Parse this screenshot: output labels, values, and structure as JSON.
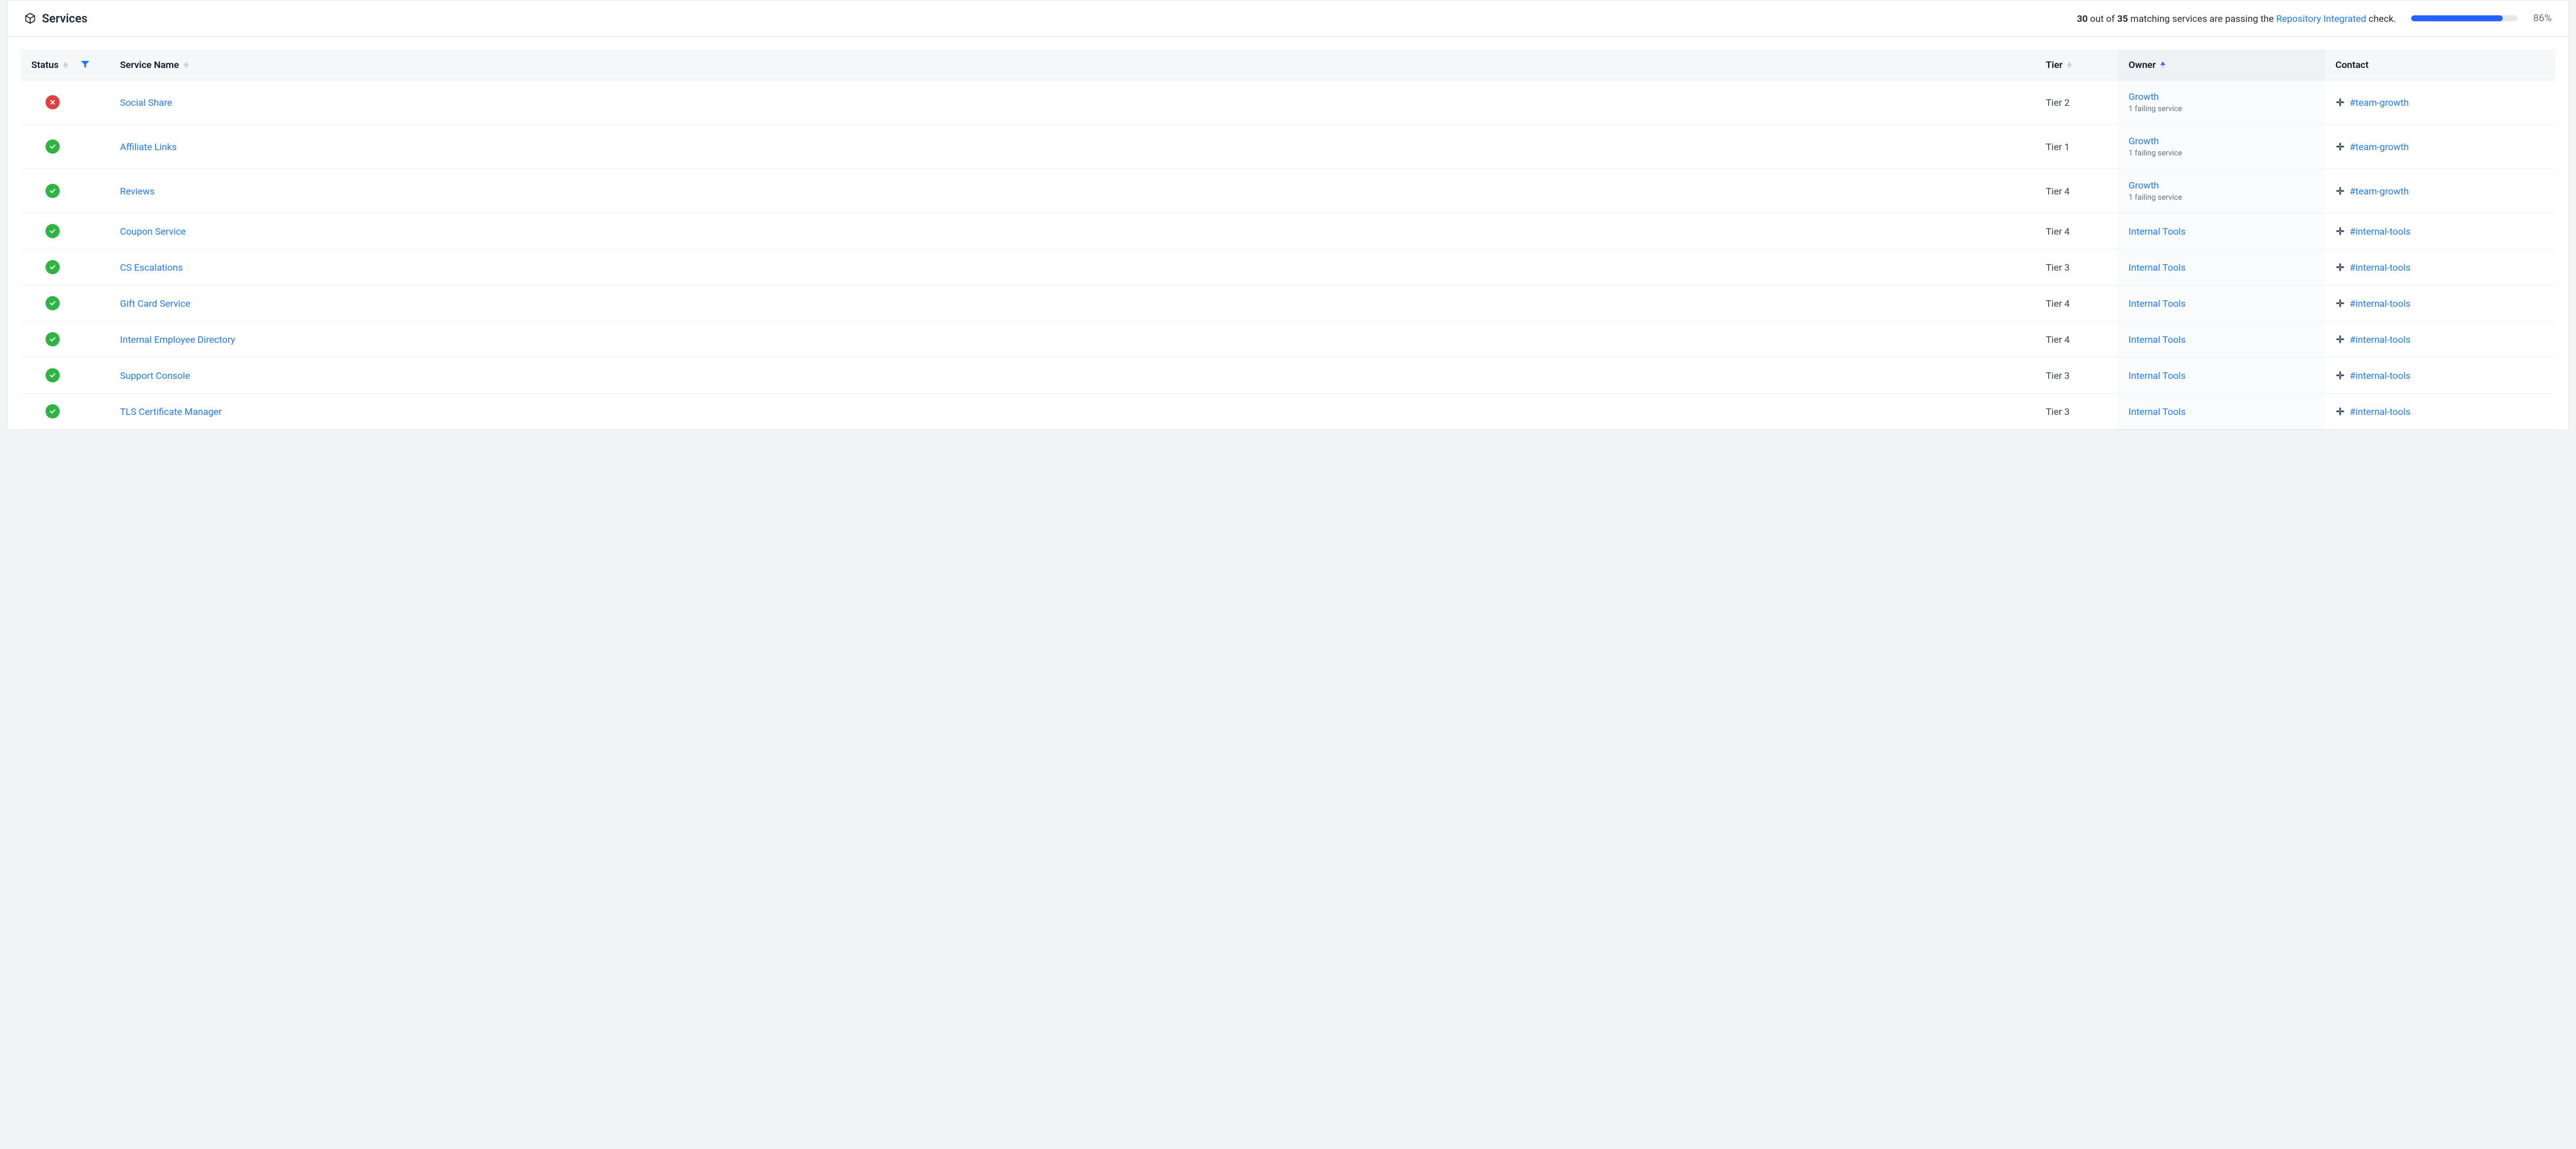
{
  "header": {
    "title": "Services",
    "summary": {
      "passing": "30",
      "total": "35",
      "pre": " out of ",
      "mid": " matching services are passing the ",
      "check_name": "Repository Integrated",
      "post": " check."
    },
    "progress_pct": 86,
    "progress_label": "86%"
  },
  "columns": {
    "status": "Status",
    "name": "Service Name",
    "tier": "Tier",
    "owner": "Owner",
    "contact": "Contact"
  },
  "rows": [
    {
      "status": "fail",
      "name": "Social Share",
      "tier": "Tier 2",
      "owner": "Growth",
      "owner_sub": "1 failing service",
      "contact": "#team-growth"
    },
    {
      "status": "pass",
      "name": "Affiliate Links",
      "tier": "Tier 1",
      "owner": "Growth",
      "owner_sub": "1 failing service",
      "contact": "#team-growth"
    },
    {
      "status": "pass",
      "name": "Reviews",
      "tier": "Tier 4",
      "owner": "Growth",
      "owner_sub": "1 failing service",
      "contact": "#team-growth"
    },
    {
      "status": "pass",
      "name": "Coupon Service",
      "tier": "Tier 4",
      "owner": "Internal Tools",
      "owner_sub": "",
      "contact": "#internal-tools"
    },
    {
      "status": "pass",
      "name": "CS Escalations",
      "tier": "Tier 3",
      "owner": "Internal Tools",
      "owner_sub": "",
      "contact": "#internal-tools"
    },
    {
      "status": "pass",
      "name": "Gift Card Service",
      "tier": "Tier 4",
      "owner": "Internal Tools",
      "owner_sub": "",
      "contact": "#internal-tools"
    },
    {
      "status": "pass",
      "name": "Internal Employee Directory",
      "tier": "Tier 4",
      "owner": "Internal Tools",
      "owner_sub": "",
      "contact": "#internal-tools"
    },
    {
      "status": "pass",
      "name": "Support Console",
      "tier": "Tier 3",
      "owner": "Internal Tools",
      "owner_sub": "",
      "contact": "#internal-tools"
    },
    {
      "status": "pass",
      "name": "TLS Certificate Manager",
      "tier": "Tier 3",
      "owner": "Internal Tools",
      "owner_sub": "",
      "contact": "#internal-tools"
    }
  ]
}
